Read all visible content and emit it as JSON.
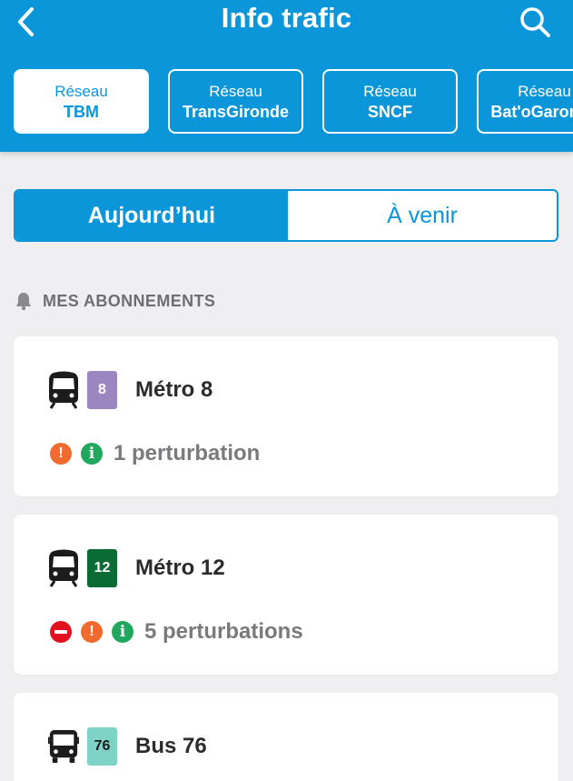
{
  "header": {
    "title": "Info trafic"
  },
  "networks": [
    {
      "prefix": "Réseau",
      "name": "TBM",
      "active": true
    },
    {
      "prefix": "Réseau",
      "name": "TransGironde",
      "active": false
    },
    {
      "prefix": "Réseau",
      "name": "SNCF",
      "active": false
    },
    {
      "prefix": "Réseau",
      "name": "Bat'oGaronne",
      "active": false
    }
  ],
  "segments": {
    "today": "Aujourd’hui",
    "upcoming": "À venir"
  },
  "section": {
    "title": "MES ABONNEMENTS",
    "icon": "bell-icon"
  },
  "subscriptions": [
    {
      "mode": "metro",
      "icon": "metro-icon",
      "badge": "8",
      "badge_color": "#9b86c2",
      "badge_text_color": "#ffffff",
      "name": "Métro 8",
      "status": "1 perturbation",
      "status_icons": [
        "alert",
        "info"
      ]
    },
    {
      "mode": "metro",
      "icon": "metro-icon",
      "badge": "12",
      "badge_color": "#0b6b34",
      "badge_text_color": "#ffffff",
      "name": "Métro 12",
      "status": "5 perturbations",
      "status_icons": [
        "stop",
        "alert",
        "info"
      ]
    },
    {
      "mode": "bus",
      "icon": "bus-icon",
      "badge": "76",
      "badge_color": "#7fd3c6",
      "badge_text_color": "#1a1a1a",
      "name": "Bus 76"
    }
  ],
  "colors": {
    "brand": "#0a96d9",
    "background": "#efeff2",
    "alert": "#f06b2d",
    "info": "#22a85e",
    "stop": "#e3101e"
  }
}
